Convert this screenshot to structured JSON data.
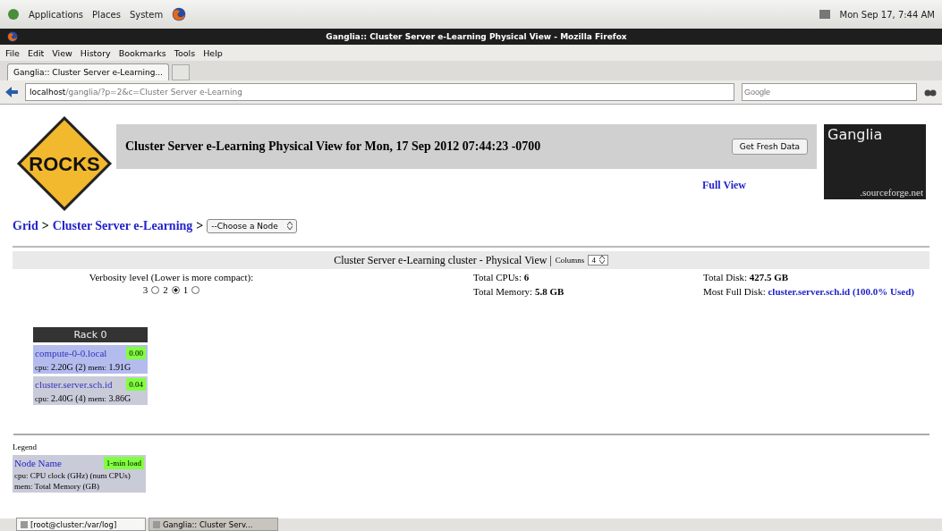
{
  "top_panel": {
    "menus": [
      "Applications",
      "Places",
      "System"
    ],
    "clock": "Mon Sep 17,  7:44 AM"
  },
  "window": {
    "title": "Ganglia:: Cluster Server e-Learning Physical View - Mozilla Firefox"
  },
  "menu_bar": [
    "File",
    "Edit",
    "View",
    "History",
    "Bookmarks",
    "Tools",
    "Help"
  ],
  "tabs": [
    {
      "label": "Ganglia:: Cluster Server e-Learning...",
      "selected": true
    }
  ],
  "address_bar": {
    "host": "localhost",
    "path": "/ganglia/?p=2&c=Cluster Server e-Learning"
  },
  "search": {
    "placeholder": "Google"
  },
  "header": {
    "logo_text": "ROCKS",
    "title": "Cluster Server e-Learning Physical View for Mon, 17 Sep 2012 07:44:23 -0700",
    "button": "Get Fresh Data",
    "full_view": "Full View",
    "ganglia_logo": {
      "title": "Ganglia",
      "subtitle": ".sourceforge.net"
    }
  },
  "breadcrumb": {
    "items": [
      "Grid",
      "Cluster Server e-Learning"
    ],
    "separator": ">",
    "node_select": "--Choose a Node"
  },
  "physical_view": {
    "title": "Cluster Server e-Learning cluster - Physical View",
    "title_separator": "|",
    "columns_label": "Columns",
    "columns_value": "4",
    "verbosity_label": "Verbosity level (Lower is more compact):",
    "verbosity": [
      {
        "label": "3",
        "selected": false
      },
      {
        "label": "2",
        "selected": true
      },
      {
        "label": "1",
        "selected": false
      }
    ],
    "stats": [
      {
        "label": "Total CPUs:",
        "value": "6"
      },
      {
        "label": "Total Memory:",
        "value": "5.8 GB"
      }
    ],
    "disk": {
      "label": "Total Disk:",
      "value": "427.5 GB",
      "full_label": "Most Full Disk:",
      "full_value": "cluster.server.sch.id (100.0% Used)"
    }
  },
  "rack": {
    "title": "Rack 0",
    "nodes": [
      {
        "name": "compute-0-0.local",
        "load": "0.00",
        "cpu_label": "cpu:",
        "cpu": "2.20G (2)",
        "mem_label": "mem:",
        "mem": "1.91G",
        "color": "#b4bced"
      },
      {
        "name": "cluster.server.sch.id",
        "load": "0.04",
        "cpu_label": "cpu:",
        "cpu": "2.40G (4)",
        "mem_label": "mem:",
        "mem": "3.86G",
        "color": "#c9cbd9"
      }
    ]
  },
  "legend": {
    "title": "Legend",
    "node_name": "Node Name",
    "load": "1-min load",
    "cpu_label": "cpu:",
    "cpu_text": "CPU clock (GHz) (num CPUs)",
    "mem_label": "mem:",
    "mem_text": "Total Memory (GB)"
  },
  "taskbar": [
    {
      "label": "[root@cluster:/var/log]",
      "selected": false
    },
    {
      "label": "Ganglia:: Cluster Serv...",
      "selected": true
    }
  ]
}
